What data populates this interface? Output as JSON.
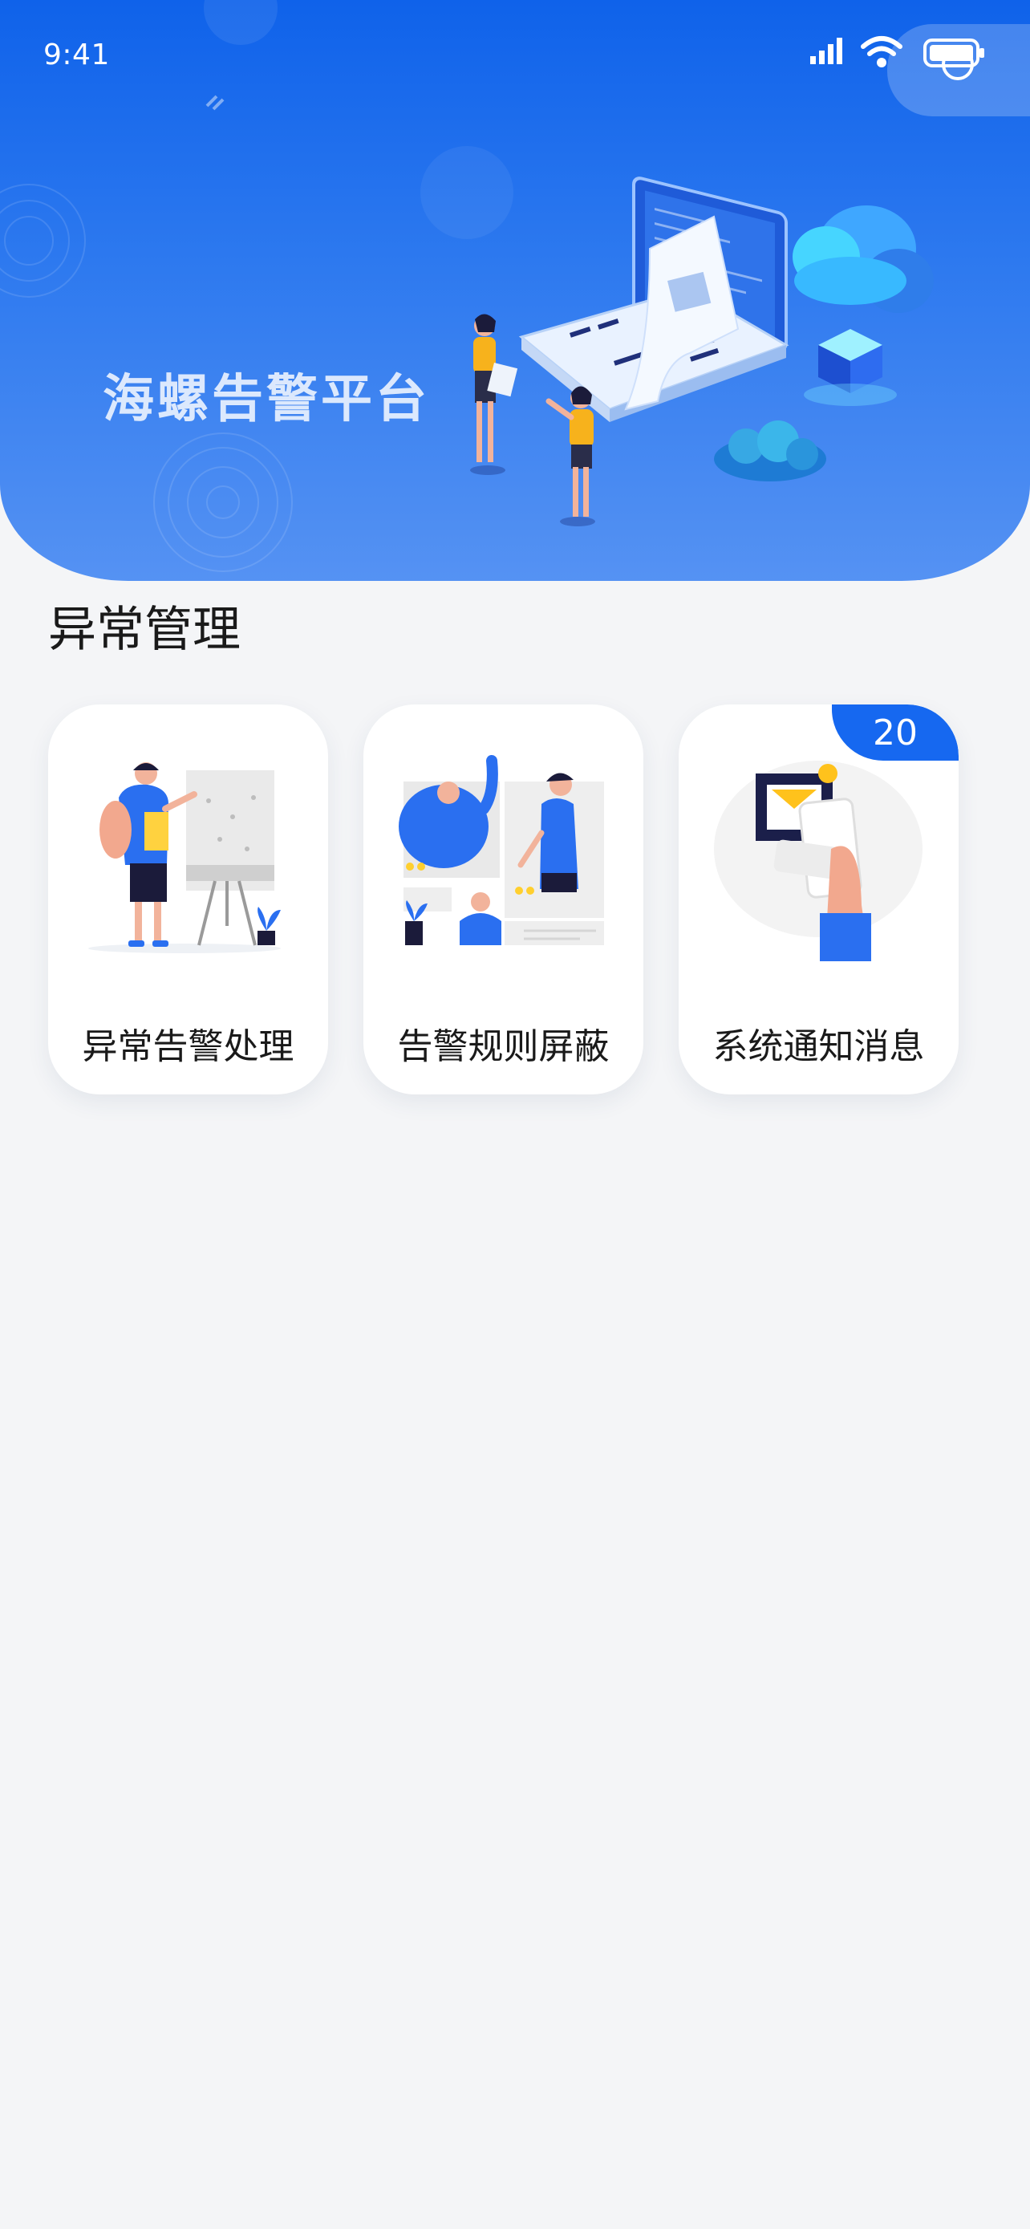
{
  "status_bar": {
    "time": "9:41"
  },
  "hero": {
    "title": "海螺告警平台"
  },
  "section": {
    "title": "异常管理"
  },
  "cards": [
    {
      "label": "异常告警处理",
      "icon": "presenter-icon"
    },
    {
      "label": "告警规则屏蔽",
      "icon": "team-board-icon"
    },
    {
      "label": "系统通知消息",
      "icon": "mail-phone-icon",
      "badge": "20"
    }
  ],
  "colors": {
    "primary": "#1668f0",
    "background": "#f4f5f7",
    "text": "#1a1a1a"
  }
}
